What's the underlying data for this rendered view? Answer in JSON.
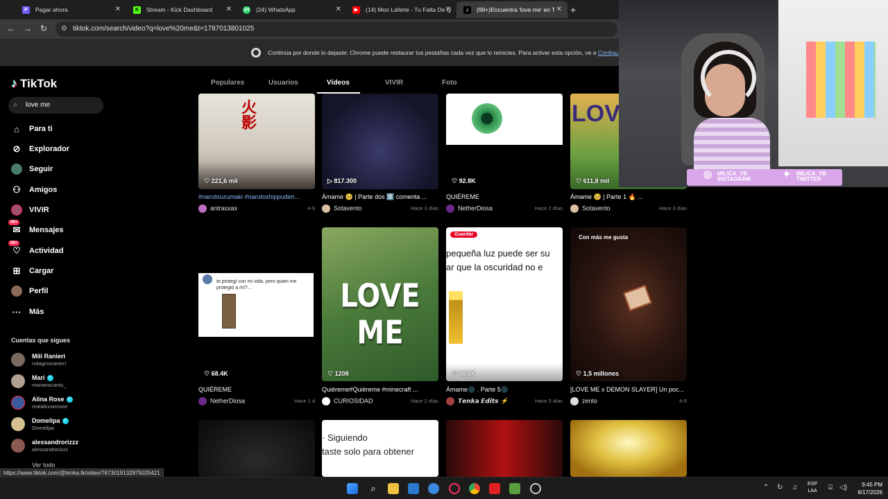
{
  "browser": {
    "tabs": [
      {
        "title": "Pagar ahora",
        "active": false
      },
      {
        "title": "Stream - Kick Dashboard",
        "active": false
      },
      {
        "title": "(24) WhatsApp",
        "active": false
      },
      {
        "title": "(14) Mon Laferte - Tu Falta De Q",
        "active": false
      },
      {
        "title": "(99+)Encuentra 'love me' en Tik",
        "active": true
      }
    ],
    "url": "tiktok.com/search/video?q=love%20me&t=1787013801025",
    "infobar_text": "Continúa por donde lo dejaste: Chrome puede restaurar tus pestañas cada vez que lo reinicies. Para activar esta opción, ve a ",
    "infobar_link": "Configu",
    "status_url": "https://www.tiktok.com/@tenka.tk/video/7673019132975025421"
  },
  "tiktok": {
    "logo_text": "TikTok",
    "search_value": "love me",
    "nav": [
      {
        "label": "Para ti",
        "icon": "home-icon"
      },
      {
        "label": "Explorador",
        "icon": "compass-icon"
      },
      {
        "label": "Seguir",
        "icon": "following-avatar"
      },
      {
        "label": "Amigos",
        "icon": "friends-icon"
      },
      {
        "label": "VIVIR",
        "icon": "live-avatar"
      },
      {
        "label": "Mensajes",
        "icon": "messages-icon",
        "badge": "99+"
      },
      {
        "label": "Actividad",
        "icon": "activity-icon",
        "badge": "99+"
      },
      {
        "label": "Cargar",
        "icon": "upload-icon"
      },
      {
        "label": "Perfil",
        "icon": "profile-avatar"
      },
      {
        "label": "Más",
        "icon": "more-icon"
      }
    ],
    "following_title": "Cuentas que sigues",
    "following": [
      {
        "name": "Mili Ranieri",
        "handle": "milagrosranieri",
        "verified": false
      },
      {
        "name": "Mari",
        "handle": "marianacantu_",
        "verified": true
      },
      {
        "name": "Alina Rose",
        "handle": "realalinnarosee",
        "verified": true
      },
      {
        "name": "Domelipa",
        "handle": "Domelipa",
        "verified": true
      },
      {
        "name": "alessandrorizzz",
        "handle": "alessandrorizzz",
        "verified": false
      }
    ],
    "see_all": "Ver todo",
    "tabs": [
      "Populares",
      "Usuarios",
      "Vídeos",
      "VIVIR",
      "Foto"
    ],
    "active_tab": "Vídeos",
    "videos": [
      {
        "likes": "221,6 mil",
        "caption": "#narutouzumaki #narutoshippuden...",
        "author": "antrasxax",
        "date": "4-9"
      },
      {
        "likes": "817.300",
        "caption": "Ámame 🥺 | Parte dos 2️⃣ comenta ...",
        "author": "Sotavento",
        "date": "Hace 3 días"
      },
      {
        "likes": "92.8K",
        "caption": "QUIÉREME",
        "author": "NetherDiosa",
        "date": "Hace 2 días"
      },
      {
        "likes": "611,8 mil",
        "caption": "Ámame 🥺 | Parte 1 🔥 ...",
        "author": "Sotavento",
        "date": "Hace 3 días"
      },
      {
        "likes": "68.4K",
        "caption": "QUIÉREME",
        "author": "NetherDiosa",
        "date": "Hace 1 d",
        "thumb_text": "te protegí con mi vida, pero quien me protegió a mí?..."
      },
      {
        "likes": "1208",
        "caption": "Quiéreme#Quiéreme #minecraft ...",
        "author": "CURIOSIDAD",
        "date": "Hace 2 días",
        "thumb_text": "LOVE ME"
      },
      {
        "likes": "98.8K",
        "caption": "Ámame🌑 . Parte 5🌑",
        "author": "𝙏𝙚𝙣𝙠𝙖 𝙀𝙙𝙞𝙩𝙨 ⚡",
        "date": "Hace 5 días",
        "thumb_text": "pequeña luz puede ser su\nar que la oscuridad no e",
        "save_label": "Guardar"
      },
      {
        "likes": "1,5 millones",
        "caption": "[LOVE ME x DEMON SLAYER] Un poc...",
        "author": "zento",
        "date": "8-8",
        "top_label": "Con más me gusta"
      },
      {
        "likes": "",
        "caption": "",
        "author": "",
        "date": ""
      },
      {
        "likes": "",
        "caption": "",
        "author": "",
        "date": "",
        "thumb_text": "· Siguiendo\ntaste solo para obtener"
      },
      {
        "likes": "",
        "caption": "",
        "author": "",
        "date": ""
      },
      {
        "likes": "",
        "caption": "",
        "author": "",
        "date": ""
      }
    ]
  },
  "stream_overlay": {
    "instagram": "MILICA_YB\nINSTAGRAM",
    "twitter": "MILICA_YB\nTWITTER"
  },
  "taskbar": {
    "lang": "ESP\nLAA",
    "time": "9:45 PM",
    "date": "8/17/2026"
  }
}
